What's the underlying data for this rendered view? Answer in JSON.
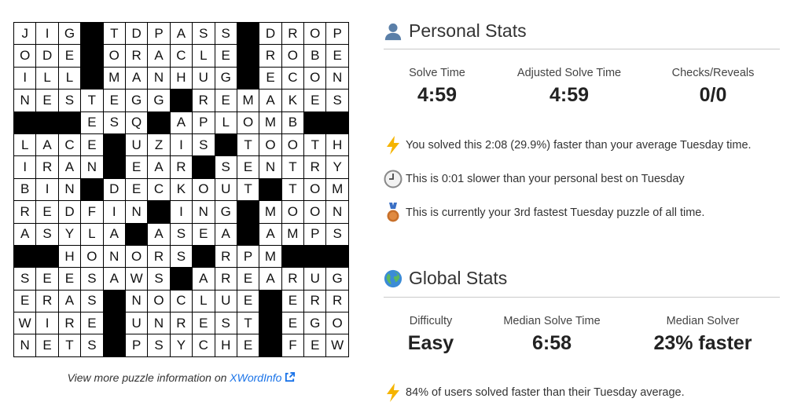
{
  "grid": {
    "rows": [
      "JIG#TDPASS#DROP",
      "ODE#ORACLE#ROBE",
      "ILL#MANHUG#ECON",
      "NESTEGG#REMAKES",
      "###ESQ#APLOMB##",
      "LACE#UZIS#TOOTH",
      "IRAN#EAR#SENTRY",
      "BIN#DECKOUT#TOM",
      "REDFIN#ING#MOON",
      "ASYLA#ASEA#AMPS",
      "##HONORS#RPM###",
      "SEESAWS#AREARUG",
      "ERAS#NOCLUE#ERR",
      "WIRE#UNREST#EGO",
      "NETS#PSYCHE#FEW"
    ]
  },
  "xwordinfo": {
    "prefix": "View more puzzle information on ",
    "link": "XWordInfo"
  },
  "personal": {
    "title": "Personal Stats",
    "icon": "person-icon",
    "stats": [
      {
        "label": "Solve Time",
        "value": "4:59"
      },
      {
        "label": "Adjusted Solve Time",
        "value": "4:59"
      },
      {
        "label": "Checks/Reveals",
        "value": "0/0"
      }
    ],
    "notes": [
      {
        "icon": "lightning-icon",
        "text": "You solved this 2:08 (29.9%) faster than your average Tuesday time."
      },
      {
        "icon": "clock-icon",
        "text": "This is 0:01 slower than your personal best on Tuesday"
      },
      {
        "icon": "bronze-medal-icon",
        "text": "This is currently your 3rd fastest Tuesday puzzle of all time."
      }
    ]
  },
  "global": {
    "title": "Global Stats",
    "icon": "globe-icon",
    "stats": [
      {
        "label": "Difficulty",
        "value": "Easy"
      },
      {
        "label": "Median Solve Time",
        "value": "6:58"
      },
      {
        "label": "Median Solver",
        "value": "23% faster"
      }
    ],
    "notes": [
      {
        "icon": "lightning-icon",
        "text": "84% of users solved faster than their Tuesday average."
      }
    ]
  },
  "colors": {
    "link": "#1a73e8",
    "lightning": "#f5b400",
    "medal": "#c8702a"
  }
}
